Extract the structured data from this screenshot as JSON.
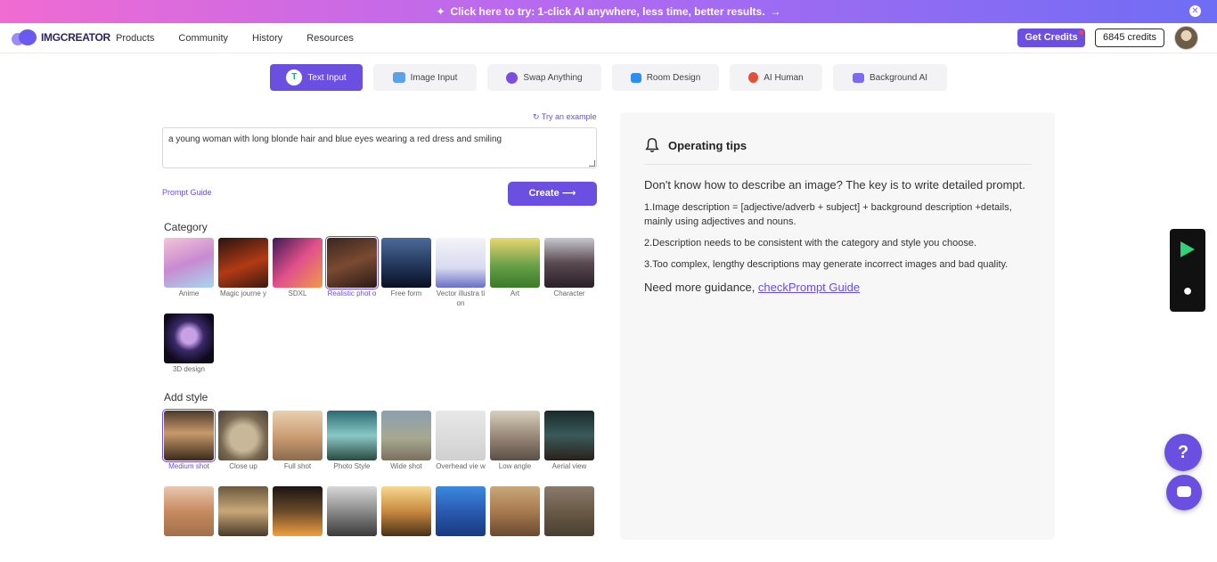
{
  "promo": {
    "text": "Click here to try: 1-click AI anywhere, less time, better results.",
    "arrow": "→",
    "close": "✕"
  },
  "header": {
    "logo": "IMGCREATOR",
    "nav": [
      "Products",
      "Community",
      "History",
      "Resources"
    ],
    "get_credits": "Get Credits",
    "credits": "6845 credits"
  },
  "tabs": [
    {
      "label": "Text Input",
      "active": true,
      "icon": "text-input-icon",
      "color": "#2aa675"
    },
    {
      "label": "Image Input",
      "icon": "image-input-icon",
      "color": "#5ba0e8"
    },
    {
      "label": "Swap Anything",
      "icon": "swap-icon",
      "color": "#7a4fe0"
    },
    {
      "label": "Room Design",
      "icon": "room-design-icon",
      "color": "#2f8ff0"
    },
    {
      "label": "AI Human",
      "icon": "ai-human-icon",
      "color": "#e0503a"
    },
    {
      "label": "Background AI",
      "icon": "background-ai-icon",
      "color": "#7a6cf0"
    }
  ],
  "form": {
    "try_example": "Try an example",
    "prompt": "a young woman with long blonde hair and blue eyes wearing a red dress and smiling",
    "prompt_guide": "Prompt Guide",
    "create": "Create"
  },
  "category": {
    "title": "Category",
    "items": [
      {
        "label": "Anime",
        "bg": "linear-gradient(160deg,#f4c4d8,#c88ad0 50%,#a6d8ef)"
      },
      {
        "label": "Magic journe y",
        "bg": "linear-gradient(160deg,#2a1410,#b23a14 55%,#3a1a10)"
      },
      {
        "label": "SDXL",
        "bg": "linear-gradient(135deg,#3d1a56,#e0508a 50%,#f19a4a)"
      },
      {
        "label": "Realistic phot o",
        "bg": "linear-gradient(160deg,#3a2620,#7a4a32 50%,#2a1a16)",
        "selected": true
      },
      {
        "label": "Free form",
        "bg": "linear-gradient(180deg,#4a6a9a,#1a2a4a 70%,#0a1020)"
      },
      {
        "label": "Vector illustra tion",
        "bg": "linear-gradient(180deg,#f4f4f8,#d8daf0 60%,#6a70c8)"
      },
      {
        "label": "Art",
        "bg": "linear-gradient(180deg,#e8d870,#6aa048 55%,#3a7a2a)"
      },
      {
        "label": "Character",
        "bg": "linear-gradient(180deg,#c8c8d0,#5a4a52 50%,#2a2028)"
      },
      {
        "label": "3D design",
        "bg": "radial-gradient(circle at 50% 45%,#c8a0e8 0 20%,#3a2a6a 40%,#0e0a1a 75%)"
      }
    ]
  },
  "style": {
    "title": "Add style",
    "items": [
      {
        "label": "Medium shot",
        "bg": "linear-gradient(180deg,#4a3a2a,#c89a6a 45%,#3a2a1a)",
        "selected": true
      },
      {
        "label": "Close up",
        "bg": "radial-gradient(circle at 50% 55%,#c8b89a 0 35%,#7a6a52 60%,#4a4038)"
      },
      {
        "label": "Full shot",
        "bg": "linear-gradient(180deg,#e8d0b0,#c89a70 55%,#8a6a50)"
      },
      {
        "label": "Photo Style",
        "bg": "linear-gradient(180deg,#2a6a70,#8ac8c8 50%,#2a4a40)"
      },
      {
        "label": "Wide shot",
        "bg": "linear-gradient(180deg,#8aa0b0,#a8a890 55%,#7a7060)"
      },
      {
        "label": "Overhead vie w",
        "bg": "linear-gradient(180deg,#e8e8e8,#d0d0d0)"
      },
      {
        "label": "Low angle",
        "bg": "linear-gradient(180deg,#d8d0c0,#9a8a78 50%,#5a5048)"
      },
      {
        "label": "Aerial view",
        "bg": "linear-gradient(180deg,#1a2a2a,#3a5a5a 50%,#2a2018)"
      },
      {
        "label": "",
        "bg": "linear-gradient(180deg,#e8c8b0,#c88a60 50%,#a0704a)"
      },
      {
        "label": "",
        "bg": "linear-gradient(180deg,#6a5a40,#c8a878 50%,#4a3a28)"
      },
      {
        "label": "",
        "bg": "linear-gradient(180deg,#1a1410,#6a4a2a 50%,#f0a040)"
      },
      {
        "label": "",
        "bg": "linear-gradient(180deg,#d8d8d8,#8a8a8a 50%,#3a3a3a)"
      },
      {
        "label": "",
        "bg": "linear-gradient(180deg,#f8d890,#c88a40 50%,#4a3018)"
      },
      {
        "label": "",
        "bg": "linear-gradient(180deg,#3a8ae0,#2a5ab0 50%,#1a3a80)"
      },
      {
        "label": "",
        "bg": "linear-gradient(180deg,#c8a878,#a87a50 50%,#6a4a30)"
      },
      {
        "label": "",
        "bg": "linear-gradient(180deg,#8a7a6a,#6a5a48 50%,#4a4030)"
      }
    ]
  },
  "tips": {
    "title": "Operating tips",
    "intro": "Don't know how to describe an image? The key is to write detailed prompt.",
    "tip1": "1.Image description = [adjective/adverb + subject] + background description +details, mainly using adjectives and nouns.",
    "tip2": "2.Description needs to be consistent with the category and style you choose.",
    "tip3": "3.Too complex, lengthy descriptions may generate incorrect images and bad quality.",
    "more": "Need more guidance, ",
    "link": "checkPrompt Guide"
  },
  "help": "?"
}
